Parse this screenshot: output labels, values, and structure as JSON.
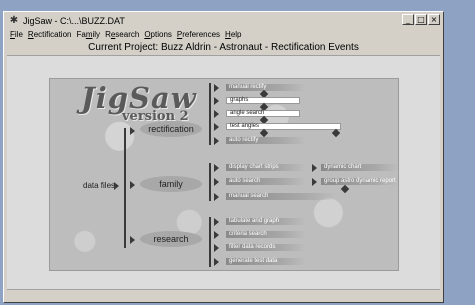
{
  "window": {
    "title": "JigSaw - C:\\...\\BUZZ.DAT",
    "controls": [
      "_",
      "□",
      "×"
    ]
  },
  "menubar": [
    {
      "label": "File",
      "mnemonic": "F"
    },
    {
      "label": "Rectification",
      "mnemonic": "R"
    },
    {
      "label": "Family",
      "mnemonic": "m"
    },
    {
      "label": "Research",
      "mnemonic": "e"
    },
    {
      "label": "Options",
      "mnemonic": "O"
    },
    {
      "label": "Preferences",
      "mnemonic": "P"
    },
    {
      "label": "Help",
      "mnemonic": "H"
    }
  ],
  "project_title": "Current Project: Buzz Aldrin - Astronaut - Rectification Events",
  "logo": {
    "name": "JigSaw",
    "version": "version 2"
  },
  "root_label": "data files",
  "groups": {
    "rectification": {
      "label": "rectification",
      "options": [
        "manual rectify",
        "graphs",
        "angle search",
        "test angles",
        "auto rectify"
      ]
    },
    "family": {
      "label": "family",
      "options": [
        "display chart strips",
        "dynamic chart",
        "auto search",
        "group astro dynamic report",
        "manual search"
      ]
    },
    "research": {
      "label": "research",
      "options": [
        "tabulate and graph",
        "criteria search",
        "filter data records",
        "generate test data"
      ]
    }
  },
  "colors": {
    "desktop": "#8ea3c4",
    "window": "#d4d0c8",
    "panel": "#bdbdbd"
  }
}
